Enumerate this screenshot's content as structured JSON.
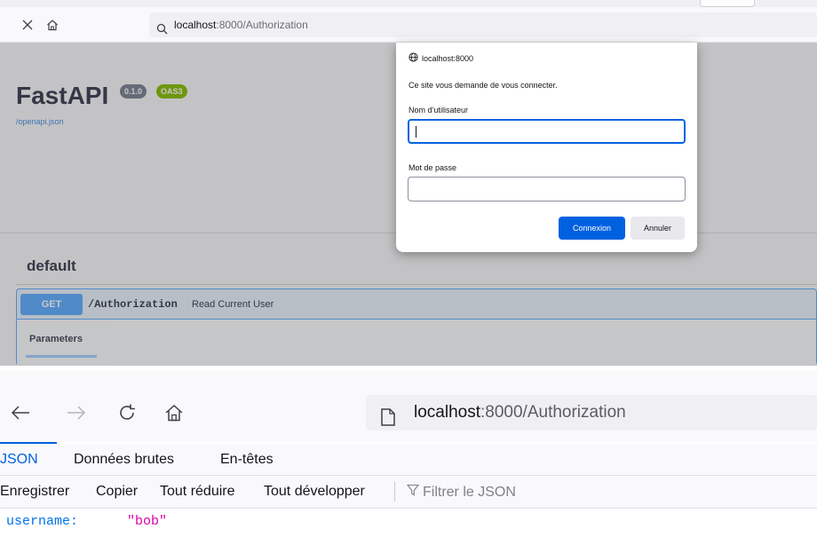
{
  "top_browser": {
    "url_host": "localhost",
    "url_path": ":8000/Authorization"
  },
  "swagger": {
    "title": "FastAPI",
    "version_badge": "0.1.0",
    "oas_badge": "OAS3",
    "openapi_link": "/openapi.json",
    "tag": "default",
    "operation": {
      "method": "GET",
      "path": "/Authorization",
      "summary": "Read Current User"
    },
    "parameters_tab": "Parameters"
  },
  "auth_dialog": {
    "origin": "localhost:8000",
    "message": "Ce site vous demande de vous connecter.",
    "username_label": "Nom d’utilisateur",
    "password_label": "Mot de passe",
    "username_value": "",
    "password_value": "",
    "connect_label": "Connexion",
    "cancel_label": "Annuler"
  },
  "bottom_browser": {
    "url_host": "localhost",
    "url_path": ":8000/Authorization"
  },
  "json_viewer": {
    "tabs": [
      "JSON",
      "Données brutes",
      "En-têtes"
    ],
    "toolbar": {
      "save": "Enregistrer",
      "copy": "Copier",
      "collapse_all": "Tout réduire",
      "expand_all": "Tout développer",
      "filter_placeholder": "Filtrer le JSON"
    },
    "rows": [
      {
        "key": "username:",
        "value": "\"bob\""
      }
    ]
  },
  "colors": {
    "accent_blue": "#0060df",
    "swagger_get": "#61affe",
    "json_key": "#0074e8",
    "json_string": "#dd00a9"
  },
  "icons": [
    "close-icon",
    "home-icon",
    "search-icon",
    "globe-icon",
    "back-icon",
    "forward-icon",
    "reload-icon",
    "page-icon",
    "filter-icon"
  ]
}
